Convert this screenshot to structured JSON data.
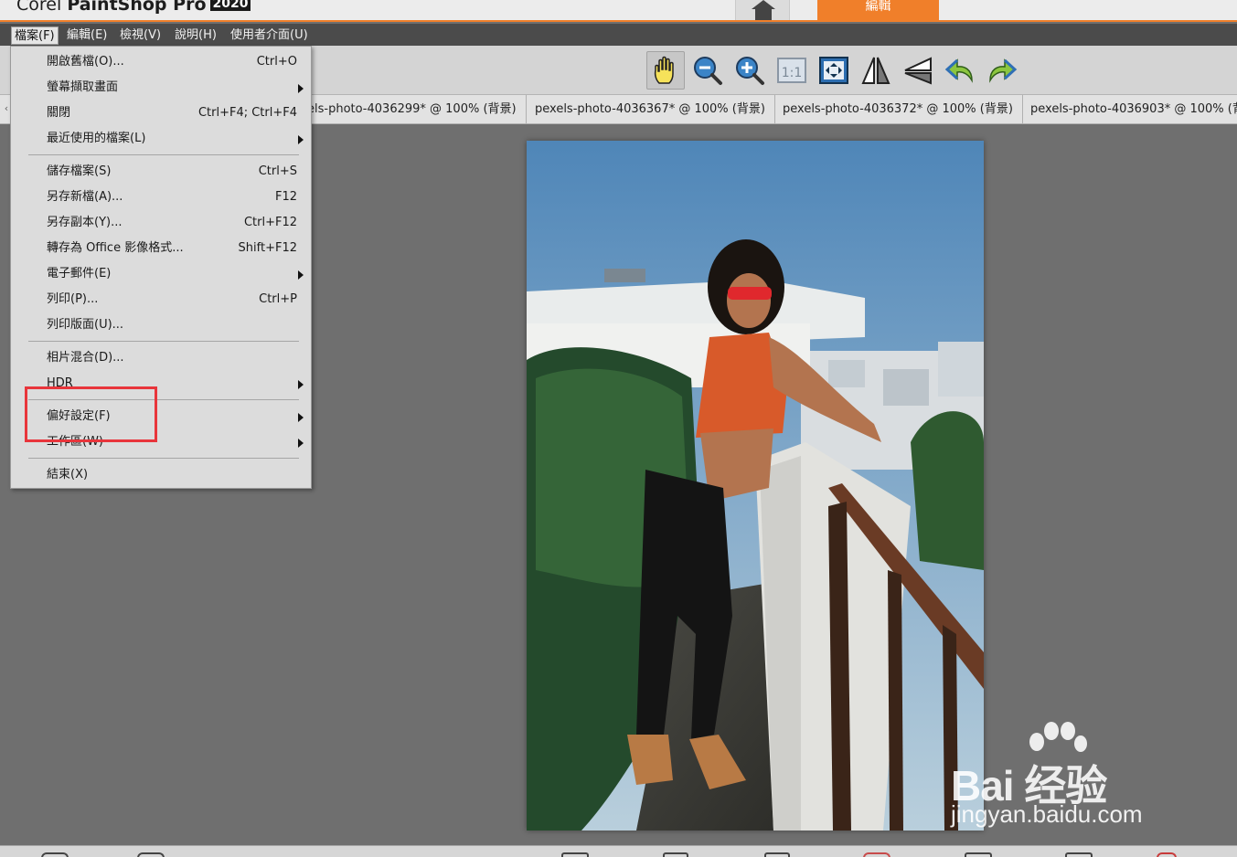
{
  "title_bar": {
    "app_name_prefix": "Corel",
    "app_name_main": "PaintShop Pro",
    "app_year": "2020",
    "tabs": {
      "home_icon": "home-icon",
      "edit_label": "編輯"
    }
  },
  "menubar": {
    "items": [
      "檔案(F)",
      "編輯(E)",
      "檢視(V)",
      "說明(H)",
      "使用者介面(U)"
    ]
  },
  "toolbar": {
    "tools": [
      {
        "name": "pan-icon",
        "selected": true
      },
      {
        "name": "zoom-out-icon"
      },
      {
        "name": "zoom-in-icon"
      },
      {
        "name": "actual-size-icon",
        "label": "1:1"
      },
      {
        "name": "fit-window-icon"
      },
      {
        "name": "flip-icon"
      },
      {
        "name": "mirror-icon"
      },
      {
        "name": "rotate-left-icon"
      },
      {
        "name": "rotate-right-icon"
      }
    ]
  },
  "document_tabs": [
    "els-photo-4036299* @ 100% (背景)",
    "pexels-photo-4036367* @ 100% (背景)",
    "pexels-photo-4036372* @ 100% (背景)",
    "pexels-photo-4036903* @ 100% (背"
  ],
  "file_menu": {
    "items": [
      {
        "label": "開啟舊檔(O)...",
        "shortcut": "Ctrl+O"
      },
      {
        "label": "螢幕擷取畫面",
        "submenu": true
      },
      {
        "label": "關閉",
        "shortcut": "Ctrl+F4; Ctrl+F4"
      },
      {
        "label": "最近使用的檔案(L)",
        "submenu": true
      },
      {
        "label": "儲存檔案(S)",
        "shortcut": "Ctrl+S"
      },
      {
        "label": "另存新檔(A)...",
        "shortcut": "F12"
      },
      {
        "label": "另存副本(Y)...",
        "shortcut": "Ctrl+F12"
      },
      {
        "label": "轉存為 Office 影像格式...",
        "shortcut": "Shift+F12"
      },
      {
        "label": "電子郵件(E)",
        "submenu": true
      },
      {
        "label": "列印(P)...",
        "shortcut": "Ctrl+P"
      },
      {
        "label": "列印版面(U)..."
      },
      {
        "label": "相片混合(D)..."
      },
      {
        "label": "HDR",
        "submenu": true
      },
      {
        "label": "偏好設定(F)",
        "submenu": true,
        "highlighted": true
      },
      {
        "label": "工作區(W)",
        "submenu": true
      },
      {
        "label": "結束(X)"
      }
    ]
  },
  "watermark": {
    "logo_text": "Bai 经验",
    "url": "jingyan.baidu.com"
  },
  "colors": {
    "accent": "#f07f2a",
    "menubar": "#4b4b4b",
    "workspace": "#6f6f6f",
    "highlight": "#e8353b"
  }
}
